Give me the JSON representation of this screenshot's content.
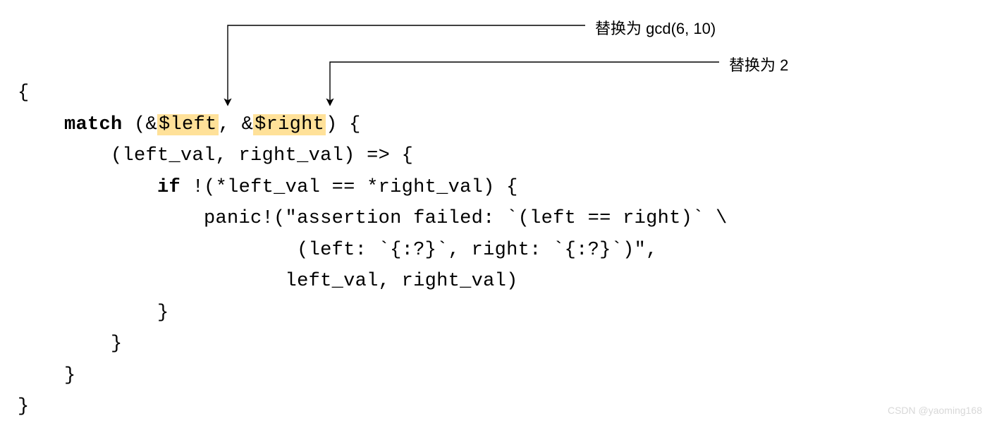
{
  "annotations": {
    "left_label": "替换为 gcd(6, 10)",
    "right_label": "替换为 2"
  },
  "code": {
    "tokens": {
      "brace_open": "{",
      "brace_close": "}",
      "match": "match",
      "if": "if",
      "left_var": "$left",
      "right_var": "$right",
      "amp1": " (&",
      "comma_amp": ", &",
      "paren_close_brace": ") {",
      "line3": "        (left_val, right_val) => {",
      "line4_pre": "            ",
      "line4_post": " !(*left_val == *right_val) {",
      "line5": "                panic!(\"assertion failed: `(left == right)` \\",
      "line6": "                        (left: `{:?}`, right: `{:?}`)\",",
      "line7": "                       left_val, right_val)",
      "line8": "            }",
      "line9": "        }",
      "line10": "    }",
      "indent_match": "    "
    }
  },
  "watermark": "CSDN @yaoming168"
}
